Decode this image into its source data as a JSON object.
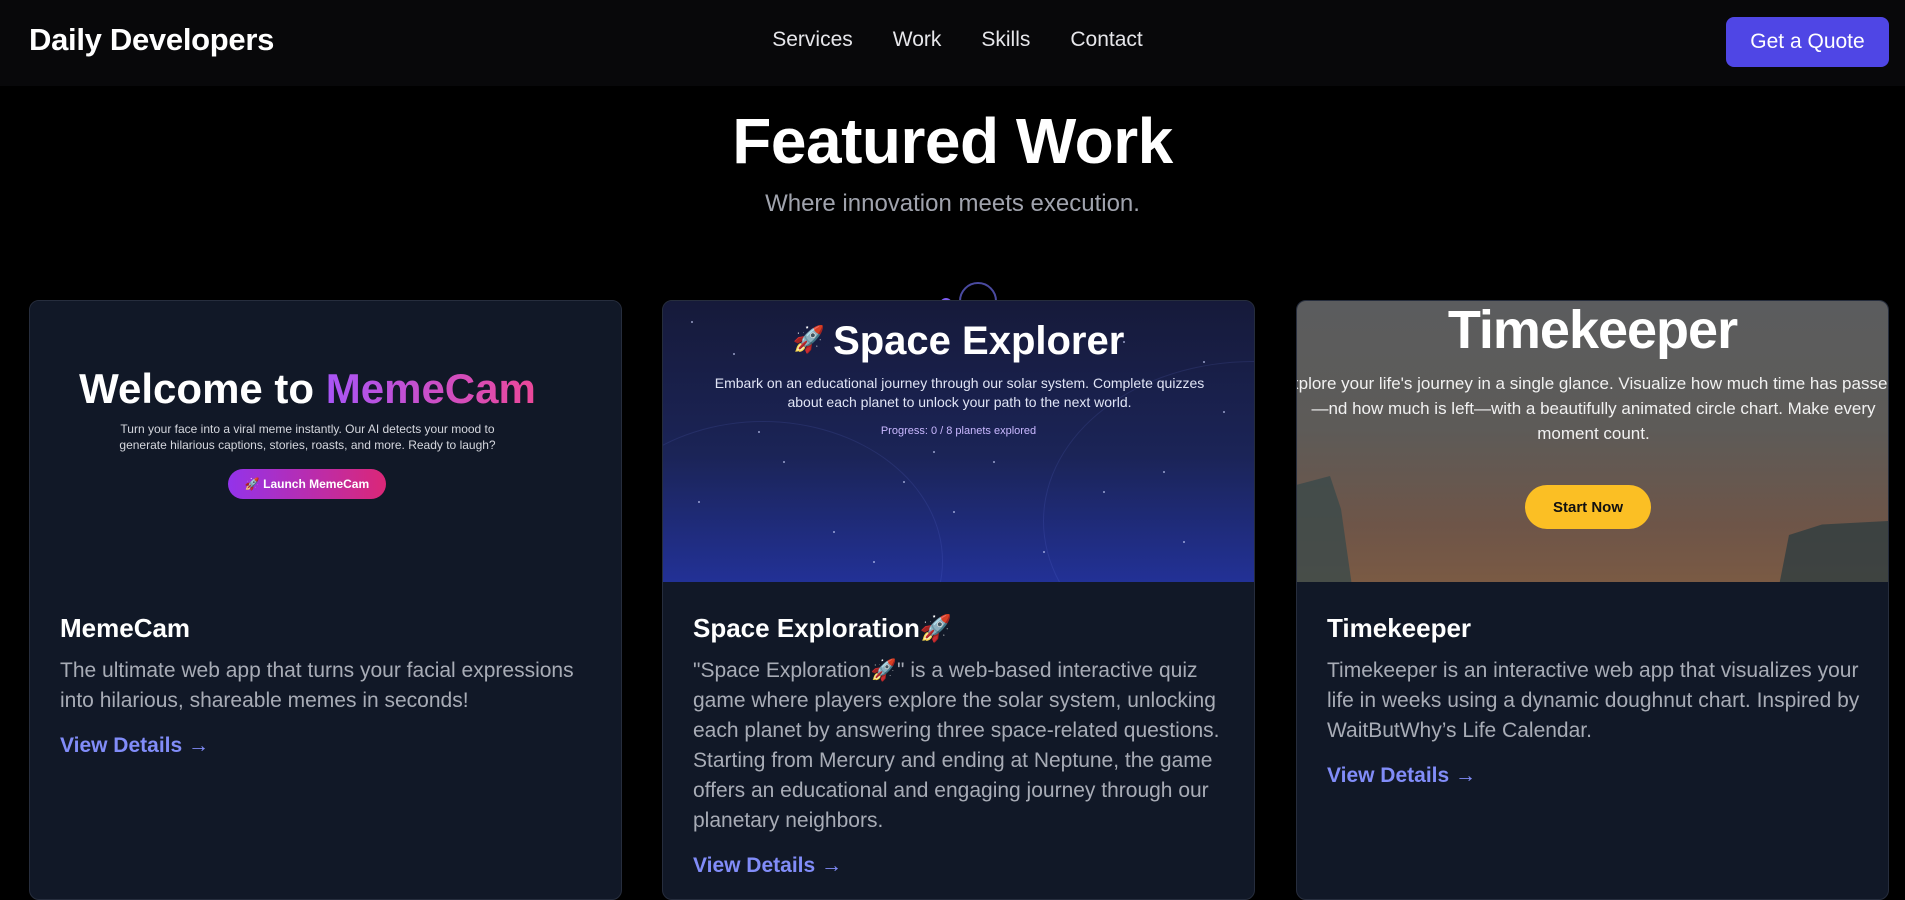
{
  "nav": {
    "brand": "Daily Developers",
    "links": [
      "Services",
      "Work",
      "Skills",
      "Contact"
    ],
    "cta": "Get a Quote"
  },
  "hero": {
    "title": "Featured Work",
    "subtitle": "Where innovation meets execution."
  },
  "projects": [
    {
      "preview": {
        "title_prefix": "Welcome to ",
        "title_accent": "MemeCam",
        "description": "Turn your face into a viral meme instantly. Our AI detects your mood to generate hilarious captions, stories, roasts, and more. Ready to laugh?",
        "button": "🚀 Launch MemeCam"
      },
      "title": "MemeCam",
      "description": "The ultimate web app that turns your facial expressions into hilarious, shareable memes in seconds!",
      "link": "View Details →"
    },
    {
      "preview": {
        "icon": "rocket-icon",
        "title": "Space Explorer",
        "description": "Embark on an educational journey through our solar system. Complete quizzes about each planet to unlock your path to the next world.",
        "progress": "Progress: 0 / 8 planets explored"
      },
      "title": "Space Exploration🚀",
      "description": "\"Space Exploration🚀\" is a web-based interactive quiz game where players explore the solar system, unlocking each planet by answering three space-related questions. Starting from Mercury and ending at Neptune, the game offers an educational and engaging journey through our planetary neighbors.",
      "link": "View Details →"
    },
    {
      "preview": {
        "title": "Timekeeper",
        "description": "xplore your life's journey in a single glance. Visualize how much time has passed—nd how much is left—with a beautifully animated circle chart. Make every moment count.",
        "button": "Start Now"
      },
      "title": "Timekeeper",
      "description": "Timekeeper is an interactive web app that visualizes your life in weeks using a dynamic doughnut chart. Inspired by WaitButWhy’s Life Calendar.",
      "link": "View Details →"
    }
  ],
  "colors": {
    "background": "#000000",
    "card": "#111827",
    "accent": "#4f46e5",
    "link": "#818cf8",
    "button_yellow": "#fbbf24"
  }
}
